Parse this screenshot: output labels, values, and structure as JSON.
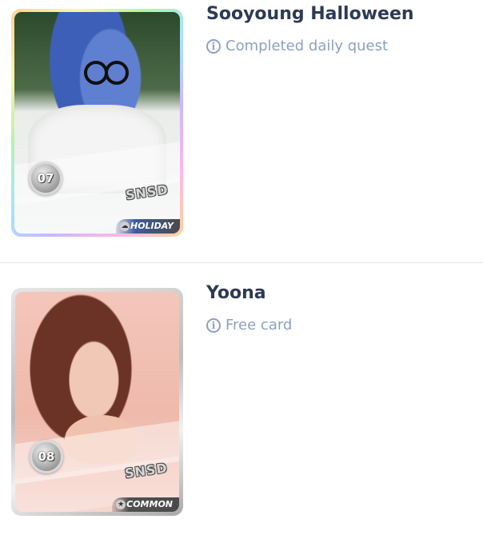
{
  "cards": [
    {
      "title": "Sooyoung Halloween",
      "description": "Completed daily quest",
      "number": "07",
      "group": "SNSD",
      "rarity": "HOLIDAY",
      "rarity_icon": "cloud-icon",
      "info_icon": "info-icon"
    },
    {
      "title": "Yoona",
      "description": "Free card",
      "number": "08",
      "group": "SNSD",
      "rarity": "COMMON",
      "rarity_icon": "star-icon",
      "info_icon": "info-icon"
    }
  ],
  "colors": {
    "title": "#2d3a54",
    "meta": "#8da0be",
    "divider": "#e2e8f0"
  }
}
